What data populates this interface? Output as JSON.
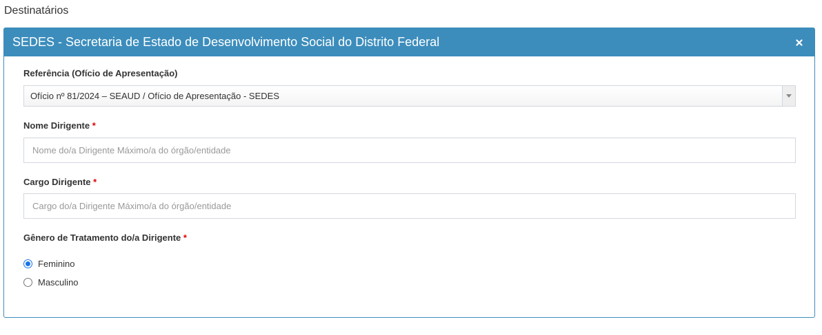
{
  "section": {
    "title": "Destinatários"
  },
  "panel": {
    "title": "SEDES - Secretaria de Estado de Desenvolvimento Social do Distrito Federal"
  },
  "fields": {
    "referencia": {
      "label": "Referência (Ofício de Apresentação)",
      "value": "Ofício nº 81/2024 – SEAUD / Ofício de Apresentação - SEDES"
    },
    "nome_dirigente": {
      "label": "Nome Dirigente",
      "required": "*",
      "placeholder": "Nome do/a Dirigente Máximo/a do órgão/entidade",
      "value": ""
    },
    "cargo_dirigente": {
      "label": "Cargo Dirigente",
      "required": "*",
      "placeholder": "Cargo do/a Dirigente Máximo/a do órgão/entidade",
      "value": ""
    },
    "genero": {
      "label": "Gênero de Tratamento do/a Dirigente",
      "required": "*",
      "options": [
        "Feminino",
        "Masculino"
      ],
      "selected": "Feminino"
    }
  },
  "colors": {
    "accent": "#3c8dbc",
    "required": "#dd0000",
    "radio": "#1a73e8"
  },
  "icons": {
    "close": "close-icon",
    "dropdown": "caret-down-icon"
  }
}
